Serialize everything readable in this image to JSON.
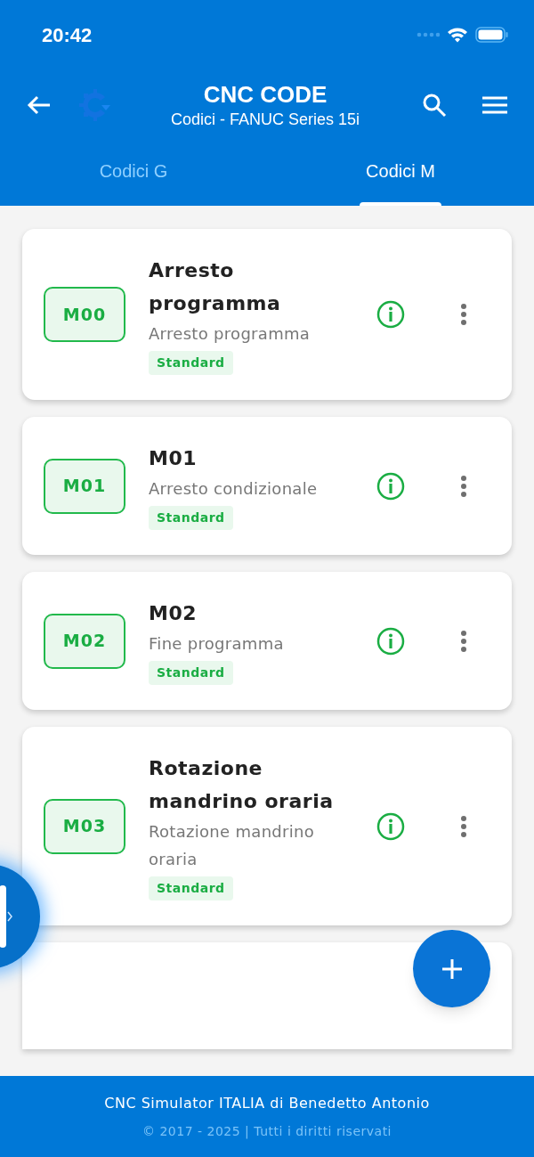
{
  "status_bar": {
    "time": "20:42"
  },
  "header": {
    "title": "CNC CODE",
    "subtitle": "Codici - FANUC Series 15i"
  },
  "tabs": [
    {
      "label": "Codici G",
      "selected": false
    },
    {
      "label": "Codici M",
      "selected": true
    }
  ],
  "codes": [
    {
      "code": "M00",
      "title": "Arresto programma",
      "description": "Arresto programma",
      "tag": "Standard"
    },
    {
      "code": "M01",
      "title": "M01",
      "description": "Arresto condizionale",
      "tag": "Standard"
    },
    {
      "code": "M02",
      "title": "M02",
      "description": "Fine programma",
      "tag": "Standard"
    },
    {
      "code": "M03",
      "title": "Rotazione mandrino oraria",
      "description": "Rotazione mandrino oraria",
      "tag": "Standard"
    }
  ],
  "footer": {
    "company": "CNC Simulator ITALIA di Benedetto Antonio",
    "copyright": "© 2017 - 2025 | Tutti i diritti riservati"
  }
}
